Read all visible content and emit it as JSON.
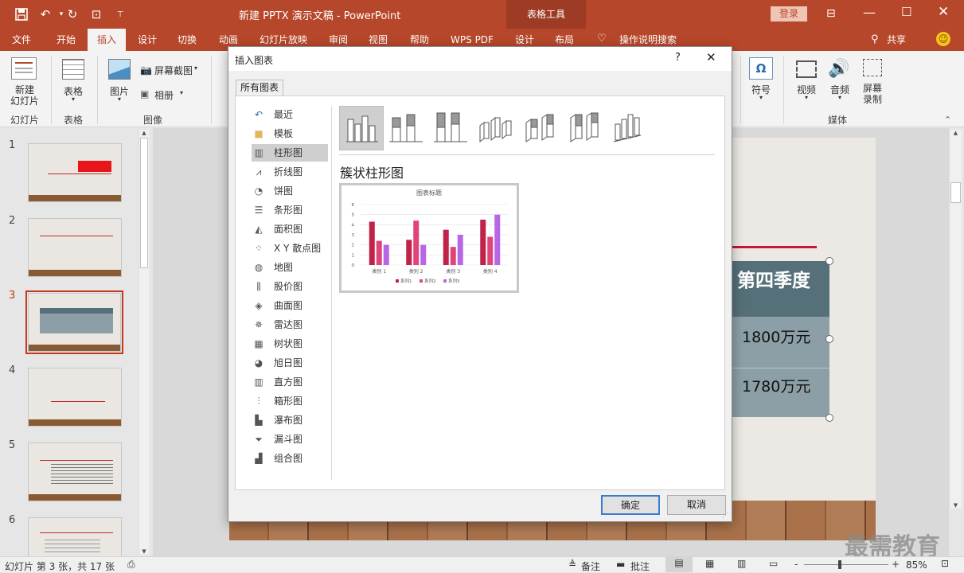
{
  "app": {
    "title": "新建 PPTX 演示文稿 - PowerPoint",
    "context_tab": "表格工具",
    "login": "登录"
  },
  "tabs": [
    "文件",
    "开始",
    "插入",
    "设计",
    "切换",
    "动画",
    "幻灯片放映",
    "审阅",
    "视图",
    "帮助",
    "WPS PDF",
    "设计",
    "布局"
  ],
  "active_tab": "插入",
  "tell_me": "操作说明搜索",
  "share": "共享",
  "ribbon": {
    "new_slide": "新建\n幻灯片",
    "table": "表格",
    "picture": "图片",
    "screenshot": "屏幕截图",
    "album": "相册",
    "symbol": "符号",
    "video": "视频",
    "audio": "音频",
    "screen_record": "屏幕\n录制",
    "groups": [
      "幻灯片",
      "表格",
      "图像",
      "媒体"
    ]
  },
  "slides": {
    "numbers": [
      "1",
      "2",
      "3",
      "4",
      "5",
      "6"
    ],
    "selected": "3"
  },
  "slide_table": {
    "header": "第四季度",
    "row1": "1800万元",
    "row2": "1780万元"
  },
  "status": {
    "slide_info": "幻灯片 第 3 张，共 17 张",
    "notes": "备注",
    "comments": "批注",
    "zoom": "85%",
    "zoom_minus": "-",
    "zoom_plus": "+"
  },
  "watermark": "最需教育",
  "dialog": {
    "title": "插入图表",
    "help": "?",
    "tab": "所有图表",
    "categories": [
      "最近",
      "模板",
      "柱形图",
      "折线图",
      "饼图",
      "条形图",
      "面积图",
      "X Y 散点图",
      "地图",
      "股价图",
      "曲面图",
      "雷达图",
      "树状图",
      "旭日图",
      "直方图",
      "箱形图",
      "瀑布图",
      "漏斗图",
      "组合图"
    ],
    "selected_category": "柱形图",
    "subtype_title": "簇状柱形图",
    "ok": "确定",
    "cancel": "取消"
  },
  "chart_data": {
    "type": "bar",
    "title": "图表标题",
    "categories": [
      "类别 1",
      "类别 2",
      "类别 3",
      "类别 4"
    ],
    "series": [
      {
        "name": "系列1",
        "values": [
          4.3,
          2.5,
          3.5,
          4.5
        ],
        "color": "#c0234a"
      },
      {
        "name": "系列2",
        "values": [
          2.4,
          4.4,
          1.8,
          2.8
        ],
        "color": "#e0457a"
      },
      {
        "name": "系列3",
        "values": [
          2.0,
          2.0,
          3.0,
          5.0
        ],
        "color": "#b767e6"
      }
    ],
    "ylim": [
      0,
      6
    ],
    "yticks": [
      "0",
      "1",
      "2",
      "3",
      "4",
      "5",
      "6"
    ],
    "legend": "bottom",
    "grid": true
  },
  "colors": {
    "accent": "#b7472a",
    "table_header": "#56707a",
    "table_body": "#8c9fa6"
  }
}
